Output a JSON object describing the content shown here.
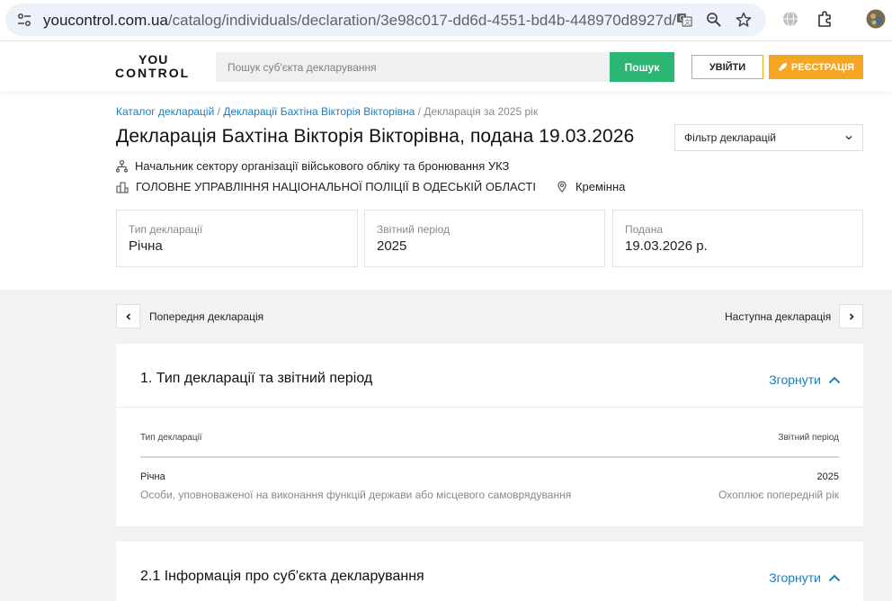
{
  "browser": {
    "url_host": "youcontrol.com.ua",
    "url_path": "/catalog/individuals/declaration/3e98c017-dd6d-4551-bd4b-448970d8927d/"
  },
  "header": {
    "logo_top": "YOU",
    "logo_bottom": "CONTROL",
    "search_placeholder": "Пошук суб'єкта декларування",
    "search_button": "Пошук",
    "login_button": "УВІЙТИ",
    "register_button": "РЕЄСТРАЦІЯ"
  },
  "breadcrumb": {
    "items": [
      "Каталог декларацій",
      "Декларації Бахтіна Вікторія Вікторівна",
      "Декларація за 2025 рік"
    ],
    "separator": "/"
  },
  "page": {
    "title": "Декларація Бахтіна Вікторія Вікторівна, подана 19.03.2026",
    "filter_label": "Фільтр декларацій",
    "position": "Начальник сектору організації військового обліку та бронювання УКЗ",
    "organization": "ГОЛОВНЕ УПРАВЛІННЯ НАЦІОНАЛЬНОЇ ПОЛІЦІЇ В ОДЕСЬКІЙ ОБЛАСТІ",
    "location": "Кремінна"
  },
  "info_cards": [
    {
      "label": "Тип декларації",
      "value": "Річна"
    },
    {
      "label": "Звітний період",
      "value": "2025"
    },
    {
      "label": "Подана",
      "value": "19.03.2026 р."
    }
  ],
  "nav": {
    "prev_label": "Попередня декларація",
    "next_label": "Наступна декларація"
  },
  "sections": [
    {
      "title": "1. Тип декларації та звітний період",
      "collapse_label": "Згорнути",
      "table": {
        "headers": [
          "Тип декларації",
          "Звітний період"
        ],
        "row": {
          "type": "Річна",
          "type_sub": "Особи, уповноваженої на виконання функцій держави або місцевого самоврядування",
          "period": "2025",
          "period_sub": "Охоплює попередній рік"
        }
      }
    },
    {
      "title": "2.1 Інформація про суб'єкта декларування",
      "collapse_label": "Згорнути"
    }
  ],
  "colors": {
    "link": "#1a7fc1",
    "search_green": "#2bb673",
    "accent_orange": "#f5a623",
    "gray_bg": "#f2f2f2"
  }
}
